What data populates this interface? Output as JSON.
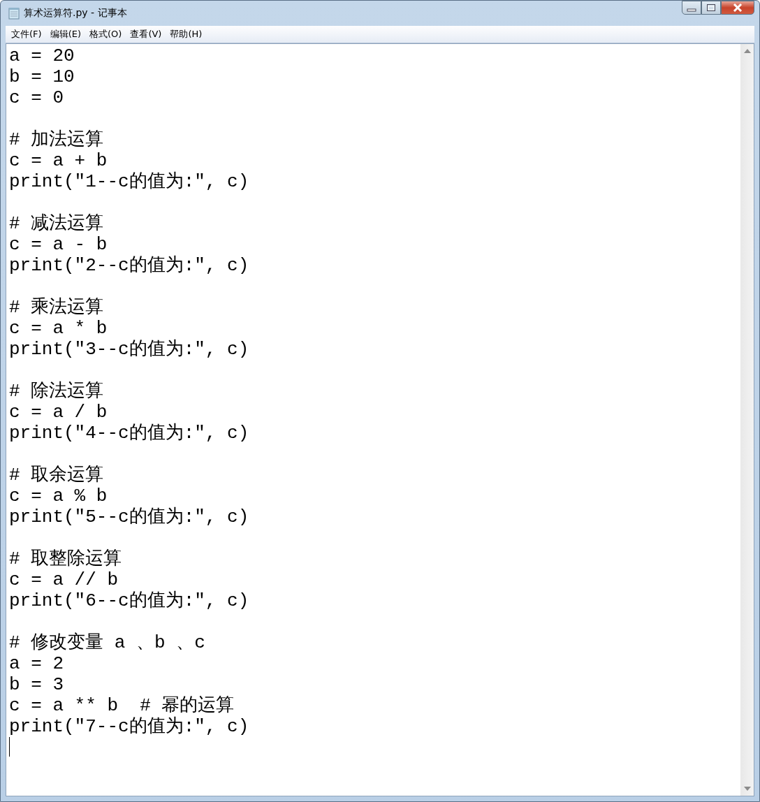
{
  "window": {
    "title": "算术运算符.py - 记事本"
  },
  "menu": [
    "文件(F)",
    "编辑(E)",
    "格式(O)",
    "查看(V)",
    "帮助(H)"
  ],
  "editor": {
    "blocks": [
      [
        "a = 20",
        "b = 10",
        "c = 0"
      ],
      [
        "# 加法运算",
        "c = a + b",
        "print(\"1--c的值为:\", c)"
      ],
      [
        "# 减法运算",
        "c = a - b",
        "print(\"2--c的值为:\", c)"
      ],
      [
        "# 乘法运算",
        "c = a * b",
        "print(\"3--c的值为:\", c)"
      ],
      [
        "# 除法运算",
        "c = a / b",
        "print(\"4--c的值为:\", c)"
      ],
      [
        "# 取余运算",
        "c = a % b",
        "print(\"5--c的值为:\", c)"
      ],
      [
        "# 取整除运算",
        "c = a // b",
        "print(\"6--c的值为:\", c)"
      ],
      [
        "# 修改变量 a 、b 、c",
        "a = 2",
        "b = 3",
        "c = a ** b  # 幂的运算",
        "print(\"7--c的值为:\", c)"
      ]
    ]
  }
}
